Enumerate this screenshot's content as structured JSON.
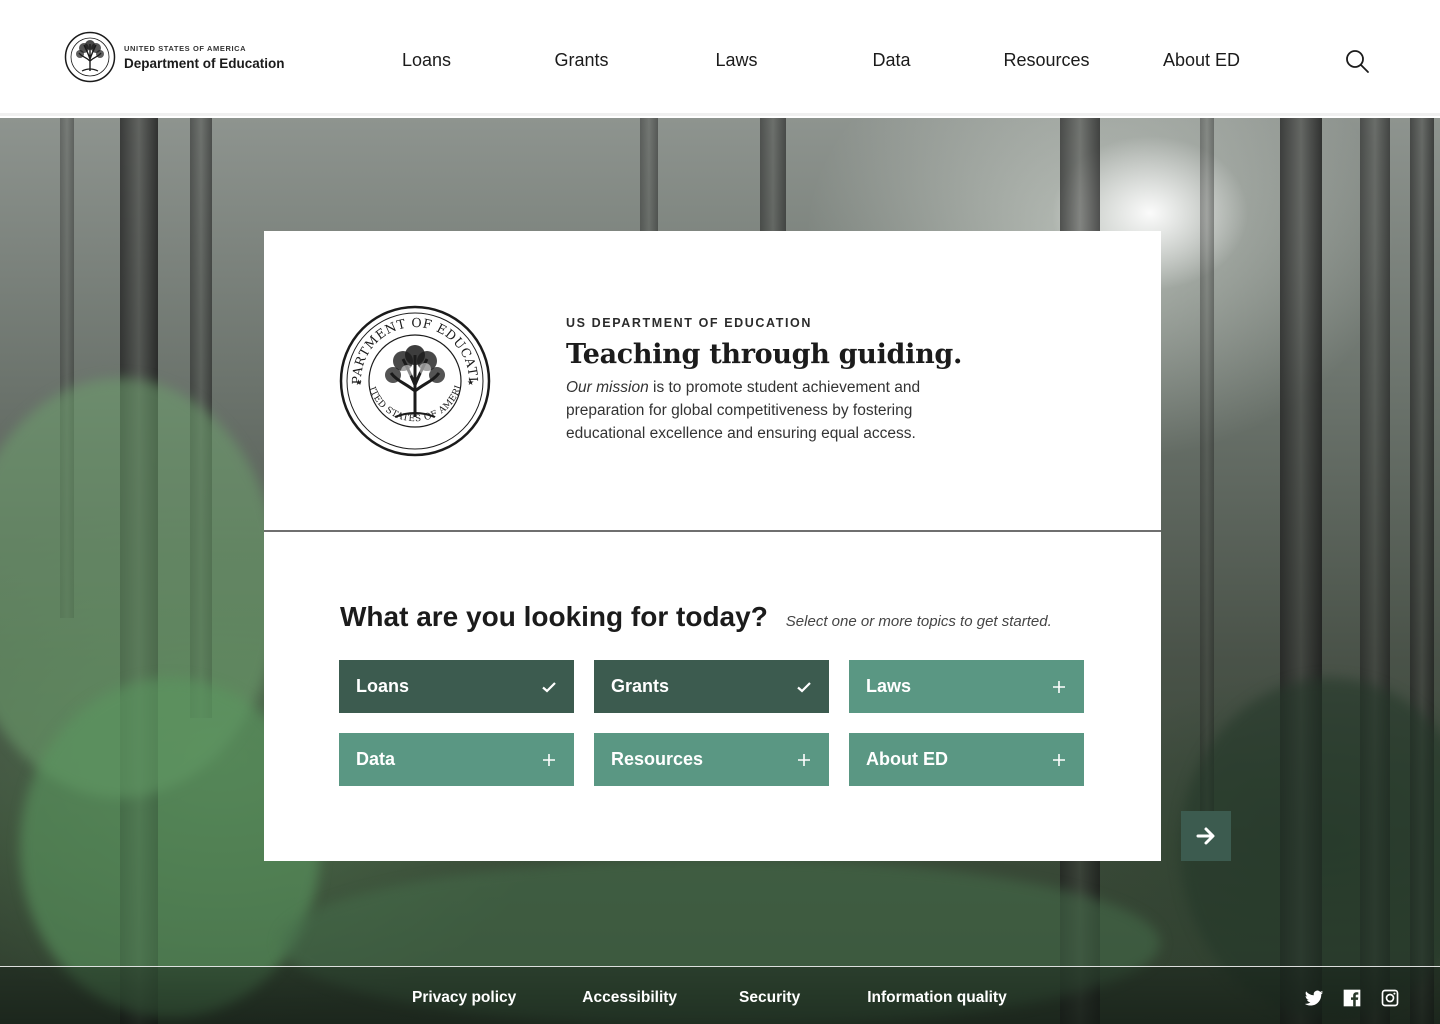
{
  "header": {
    "logo": {
      "small_text": "UNITED STATES OF AMERICA",
      "name": "Department of Education"
    },
    "nav": [
      {
        "label": "Loans"
      },
      {
        "label": "Grants"
      },
      {
        "label": "Laws"
      },
      {
        "label": "Data"
      },
      {
        "label": "Resources"
      },
      {
        "label": "About ED"
      }
    ],
    "search_icon": "search-icon"
  },
  "hero": {
    "seal_icon": "department-of-education-seal",
    "seal_text_top": "DEPARTMENT OF EDUCATION",
    "seal_text_bottom": "UNITED STATES OF AMERICA",
    "eyebrow": "US DEPARTMENT OF EDUCATION",
    "headline": "Teaching through guiding.",
    "mission_emphasis": "Our mission",
    "mission_rest": " is to promote student achievement and preparation for global competitiveness by fostering educational excellence and ensuring equal access."
  },
  "topics": {
    "question": "What are you looking for today?",
    "hint": "Select one or more topics to get started.",
    "items": [
      {
        "label": "Loans",
        "selected": true
      },
      {
        "label": "Grants",
        "selected": true
      },
      {
        "label": "Laws",
        "selected": false
      },
      {
        "label": "Data",
        "selected": false
      },
      {
        "label": "Resources",
        "selected": false
      },
      {
        "label": "About ED",
        "selected": false
      }
    ],
    "selected_color": "#3c5b4f",
    "unselected_color": "#5a9783",
    "next_icon": "arrow-right-icon"
  },
  "footer": {
    "links": [
      {
        "label": "Privacy policy"
      },
      {
        "label": "Accessibility"
      },
      {
        "label": "Security"
      },
      {
        "label": "Information quality"
      }
    ],
    "social": [
      "twitter-icon",
      "facebook-icon",
      "instagram-icon"
    ]
  }
}
